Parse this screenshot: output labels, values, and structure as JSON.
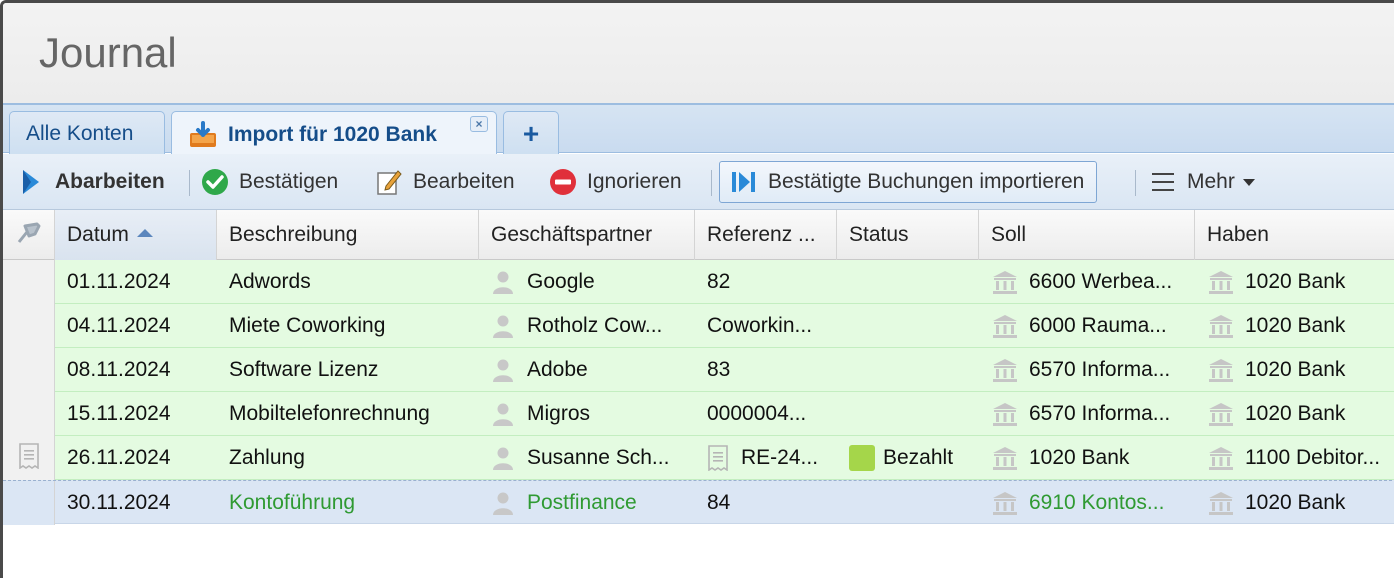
{
  "window": {
    "title": "Journal"
  },
  "tabs": [
    {
      "label": "Alle Konten"
    },
    {
      "label": "Import für 1020 Bank",
      "close": "×"
    },
    {
      "label": "+"
    }
  ],
  "toolbar": {
    "process": "Abarbeiten",
    "confirm": "Bestätigen",
    "edit": "Bearbeiten",
    "ignore": "Ignorieren",
    "import_confirmed": "Bestätigte Buchungen importieren",
    "more": "Mehr"
  },
  "columns": {
    "date": "Datum",
    "description": "Beschreibung",
    "partner": "Geschäftspartner",
    "reference": "Referenz ...",
    "status": "Status",
    "debit": "Soll",
    "credit": "Haben"
  },
  "rows": [
    {
      "date": "01.11.2024",
      "description": "Adwords",
      "partner": "Google",
      "reference": "82",
      "status": "",
      "debit": "6600 Werbea...",
      "credit": "1020 Bank"
    },
    {
      "date": "04.11.2024",
      "description": "Miete Coworking",
      "partner": "Rotholz Cow...",
      "reference": "Coworkin...",
      "status": "",
      "debit": "6000 Rauma...",
      "credit": "1020 Bank"
    },
    {
      "date": "08.11.2024",
      "description": "Software Lizenz",
      "partner": "Adobe",
      "reference": "83",
      "status": "",
      "debit": "6570 Informa...",
      "credit": "1020 Bank"
    },
    {
      "date": "15.11.2024",
      "description": "Mobiltelefonrechnung",
      "partner": "Migros",
      "reference": "0000004...",
      "status": "",
      "debit": "6570 Informa...",
      "credit": "1020 Bank"
    },
    {
      "date": "26.11.2024",
      "description": "Zahlung",
      "partner": "Susanne Sch...",
      "reference": "RE-24...",
      "status": "Bezahlt",
      "debit": "1020 Bank",
      "credit": "1100 Debitor..."
    },
    {
      "date": "30.11.2024",
      "description": "Kontoführung",
      "partner": "Postfinance",
      "reference": "84",
      "status": "",
      "debit": "6910 Kontos...",
      "credit": "1020 Bank"
    }
  ],
  "colors": {
    "row_bg": "#e4fbe1",
    "selected_bg": "#dbe6f4",
    "status_paid": "#a5d64a",
    "green_text": "#2f9a32",
    "tab_text": "#154d89"
  }
}
